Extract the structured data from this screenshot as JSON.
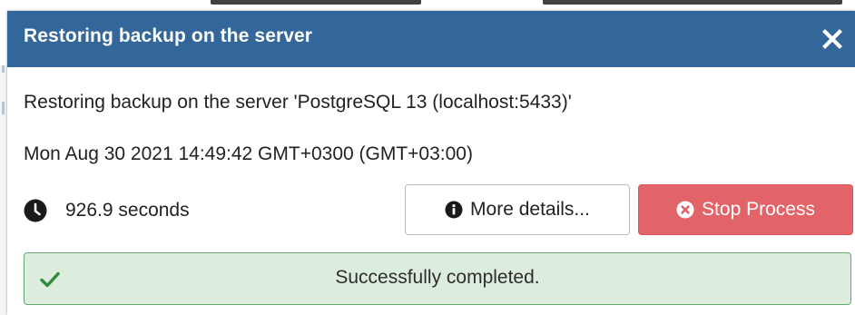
{
  "dialog": {
    "title": "Restoring backup on the server",
    "close_icon": "close-icon",
    "message": "Restoring backup on the server 'PostgreSQL 13 (localhost:5433)'",
    "timestamp": "Mon Aug 30 2021 14:49:42 GMT+0300 (GMT+03:00)",
    "duration": "926.9 seconds",
    "duration_icon": "clock-icon",
    "buttons": {
      "details_label": "More details...",
      "details_icon": "info-circle-icon",
      "stop_label": "Stop Process",
      "stop_icon": "times-circle-icon"
    },
    "status": {
      "text": "Successfully completed.",
      "icon": "check-icon"
    }
  },
  "colors": {
    "header_bg": "#336699",
    "stop_button_bg": "#e36468",
    "success_bg": "#dcedde",
    "success_border": "#61a96d",
    "success_icon": "#2e8b3c"
  }
}
